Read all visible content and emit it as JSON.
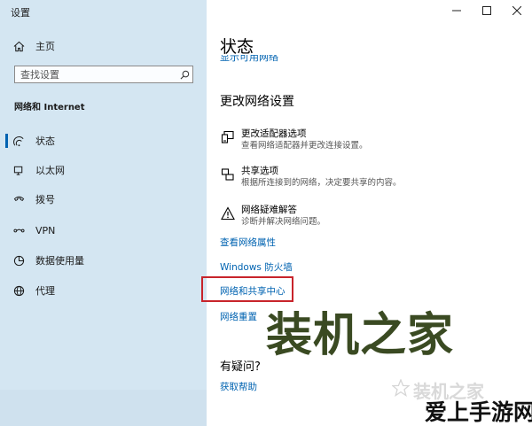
{
  "window": {
    "title": "设置"
  },
  "sidebar": {
    "home_label": "主页",
    "search_placeholder": "查找设置",
    "section_label": "网络和 Internet",
    "items": [
      {
        "label": "状态",
        "icon": "status-icon",
        "active": true
      },
      {
        "label": "以太网",
        "icon": "ethernet-icon"
      },
      {
        "label": "拨号",
        "icon": "dialup-icon"
      },
      {
        "label": "VPN",
        "icon": "vpn-icon"
      },
      {
        "label": "数据使用量",
        "icon": "data-usage-icon"
      },
      {
        "label": "代理",
        "icon": "proxy-globe-icon"
      }
    ]
  },
  "main": {
    "page_title": "状态",
    "clipped_link": "显示可用网络",
    "change_heading": "更改网络设置",
    "options": [
      {
        "title": "更改适配器选项",
        "desc": "查看网络适配器并更改连接设置。",
        "icon": "adapter-icon"
      },
      {
        "title": "共享选项",
        "desc": "根据所连接到的网络，决定要共享的内容。",
        "icon": "sharing-icon"
      },
      {
        "title": "网络疑难解答",
        "desc": "诊断并解决网络问题。",
        "icon": "warning-icon"
      }
    ],
    "links": {
      "view_properties": "查看网络属性",
      "firewall": "Windows 防火墙",
      "sharing_center": "网络和共享中心",
      "reset": "网络重置"
    },
    "help_heading": "有疑问?",
    "help_link": "获取帮助"
  },
  "watermarks": {
    "main": "装机之家",
    "faint": "装机之家",
    "bottom": "爱上手游网"
  },
  "colors": {
    "sidebar_bg": "#d4e6f2",
    "accent": "#0063b1",
    "highlight_border": "#c8242b"
  }
}
